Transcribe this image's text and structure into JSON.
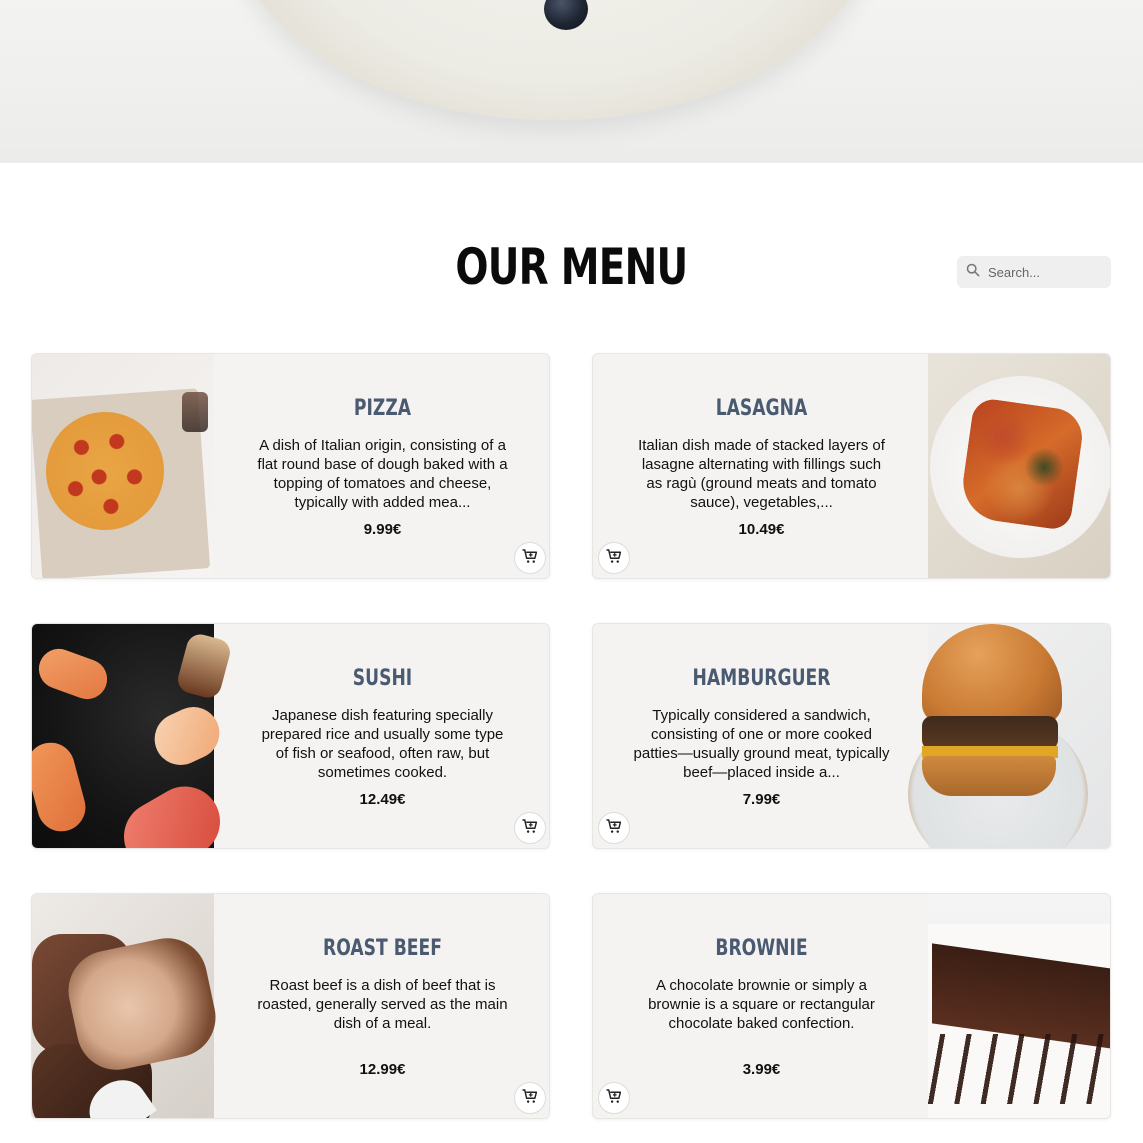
{
  "header": {
    "title": "OUR MENU",
    "search_placeholder": "Search..."
  },
  "menu": [
    {
      "name": "PIZZA",
      "description": "A dish of Italian origin, consisting of a flat round base of dough baked with a topping of tomatoes and cheese, typically with added mea...",
      "price": "9.99€",
      "image": "pizza-photo"
    },
    {
      "name": "LASAGNA",
      "description": "Italian dish made of stacked layers of lasagne alternating with fillings such as ragù (ground meats and tomato sauce), vegetables,...",
      "price": "10.49€",
      "image": "lasagna-photo"
    },
    {
      "name": "SUSHI",
      "description": "Japanese dish featuring specially prepared rice and usually some type of fish or seafood, often raw, but sometimes cooked.",
      "price": "12.49€",
      "image": "sushi-photo"
    },
    {
      "name": "HAMBURGUER",
      "description": "Typically considered a sandwich, consisting of one or more cooked patties—usually ground meat, typically beef—placed inside a...",
      "price": "7.99€",
      "image": "hamburger-photo"
    },
    {
      "name": "ROAST BEEF",
      "description": "Roast beef is a dish of beef that is roasted, generally served as the main dish of a meal.",
      "price": "12.99€",
      "image": "roast-beef-photo"
    },
    {
      "name": "BROWNIE",
      "description": "A chocolate brownie or simply a brownie is a square or rectangular chocolate baked confection.",
      "price": "3.99€",
      "image": "brownie-photo"
    }
  ],
  "icons": {
    "search": "search-icon",
    "cart": "cart-icon"
  },
  "colors": {
    "item_name": "#4a5a70",
    "card_background": "#f4f3f1",
    "title": "#0b0b0b"
  }
}
